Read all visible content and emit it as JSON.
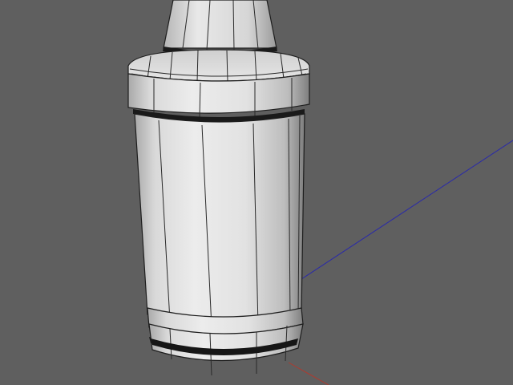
{
  "viewport": {
    "background": "#5f5f5f",
    "mode": "shaded-with-wireframe"
  },
  "scene": {
    "object": "bottle-model",
    "colors": {
      "body_light": "#e4e4e4",
      "body_mid": "#c8c8c8",
      "body_dark": "#8a8a8a",
      "edge": "#1e1e1e",
      "band": "#1a1a1a"
    }
  },
  "axes": {
    "x_axis_color": "#b03a2e",
    "z_axis_color": "#2a2aa8"
  }
}
